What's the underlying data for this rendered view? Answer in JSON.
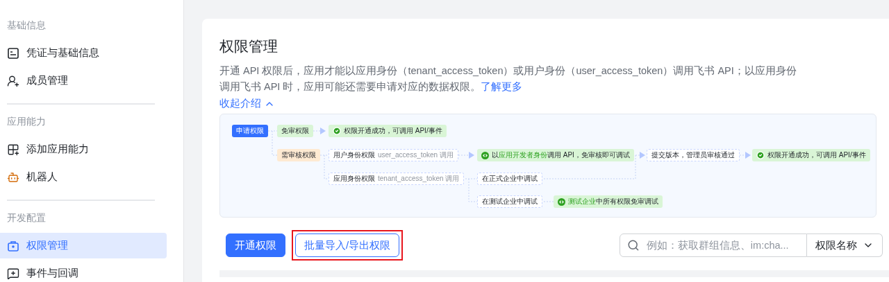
{
  "sidebar": {
    "sections": [
      {
        "title": "基础信息",
        "items": [
          {
            "label": "凭证与基础信息",
            "selected": false
          },
          {
            "label": "成员管理",
            "selected": false
          }
        ]
      },
      {
        "title": "应用能力",
        "items": [
          {
            "label": "添加应用能力",
            "selected": false
          },
          {
            "label": "机器人",
            "selected": false
          }
        ]
      },
      {
        "title": "开发配置",
        "items": [
          {
            "label": "权限管理",
            "selected": true
          },
          {
            "label": "事件与回调",
            "selected": false
          }
        ]
      }
    ]
  },
  "page": {
    "title": "权限管理",
    "description": "开通 API 权限后，应用才能以应用身份（tenant_access_token）或用户身份（user_access_token）调用飞书 API；以应用身份调用飞书 API 时，应用可能还需要申请对应的数据权限。",
    "learn_more": "了解更多",
    "collapse": "收起介绍",
    "diagram": {
      "nodes": [
        {
          "kind": "start",
          "segments": [
            {
              "text": "申请权限",
              "highlight": false
            }
          ]
        },
        {
          "kind": "free",
          "segments": [
            {
              "text": "免审权限",
              "highlight": false
            }
          ]
        },
        {
          "kind": "success",
          "segments": [
            {
              "text": "权限开通成功，可调用 API/事件",
              "highlight": false
            }
          ]
        },
        {
          "kind": "review",
          "segments": [
            {
              "text": "需审核权限",
              "highlight": false
            }
          ]
        },
        {
          "kind": "scope",
          "segments": [
            {
              "text": "用户身份权限",
              "highlight": false
            }
          ],
          "note": "user_access_token 调用"
        },
        {
          "kind": "info",
          "segments": [
            {
              "text": "以",
              "highlight": false
            },
            {
              "text": "应用开发者身份",
              "highlight": true
            },
            {
              "text": "调用 API，免审核即可调试",
              "highlight": false
            }
          ]
        },
        {
          "kind": "step",
          "segments": [
            {
              "text": "提交版本，管理员审核通过",
              "highlight": false
            }
          ]
        },
        {
          "kind": "success",
          "segments": [
            {
              "text": "权限开通成功，可调用 API/事件",
              "highlight": false
            }
          ]
        },
        {
          "kind": "scope",
          "segments": [
            {
              "text": "应用身份权限",
              "highlight": false
            }
          ],
          "note": "tenant_access_token 调用"
        },
        {
          "kind": "step",
          "segments": [
            {
              "text": "在正式企业中调试",
              "highlight": false
            }
          ]
        },
        {
          "kind": "step",
          "segments": [
            {
              "text": "在测试企业中调试",
              "highlight": false
            }
          ]
        },
        {
          "kind": "info",
          "segments": [
            {
              "text": "测试企业",
              "highlight": true
            },
            {
              "text": "中所有权限免审调试",
              "highlight": false
            }
          ]
        }
      ]
    },
    "buttons": [
      {
        "label": "开通权限",
        "kind": "primary",
        "highlighted": false
      },
      {
        "label": "批量导入/导出权限",
        "kind": "outline",
        "highlighted": true
      }
    ],
    "search": {
      "placeholder": "例如：获取群组信息、im:cha..."
    },
    "filter": {
      "value": "权限名称"
    }
  }
}
